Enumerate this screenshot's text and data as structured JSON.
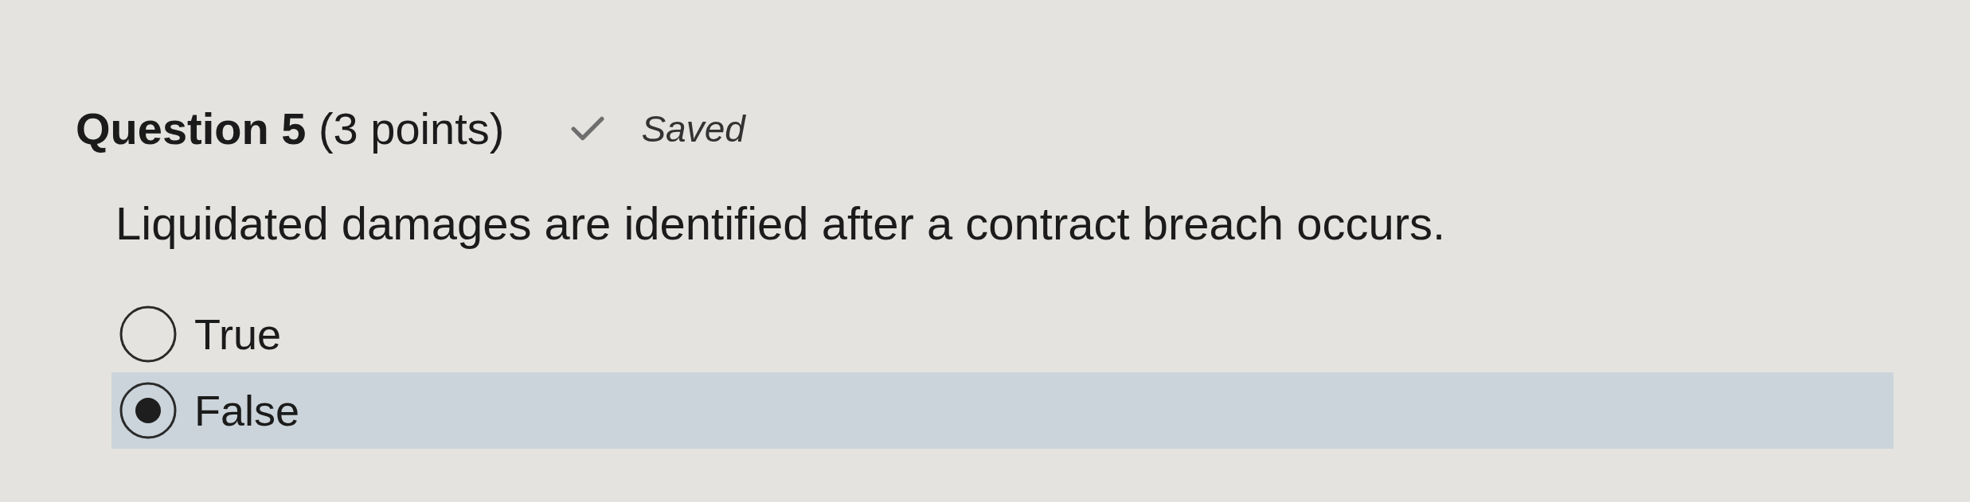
{
  "question": {
    "title": "**Question 5** (3 points)",
    "save_status": "Saved",
    "prompt": "Liquidated damages are identified after a contract breach occurs."
  },
  "options": [
    {
      "label": "True",
      "selected": false
    },
    {
      "label": "False",
      "selected": true
    }
  ]
}
